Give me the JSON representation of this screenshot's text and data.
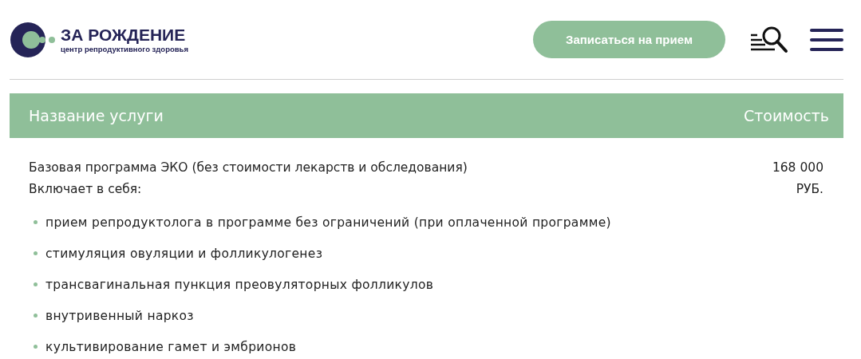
{
  "header": {
    "logo": {
      "name": "ЗА РОЖДЕНИЕ",
      "tagline": "центр репродуктивного здоровья"
    },
    "cta_button": "Записаться на прием"
  },
  "table": {
    "columns": [
      "Название услуги",
      "Стоимость"
    ],
    "rows": [
      {
        "name": "Базовая программа ЭКО (без стоимости лекарств и обследования)",
        "subtitle": "Включает в себя:",
        "price": "168 000",
        "currency": "РУБ.",
        "items": [
          "прием репродуктолога в программе без ограничений (при оплаченной программе)",
          "стимуляция овуляции и фолликулогенез",
          "трансвагинальная пункция преовуляторных фолликулов",
          "внутривенный наркоз",
          "культивирование гамет и эмбрионов"
        ]
      }
    ]
  }
}
